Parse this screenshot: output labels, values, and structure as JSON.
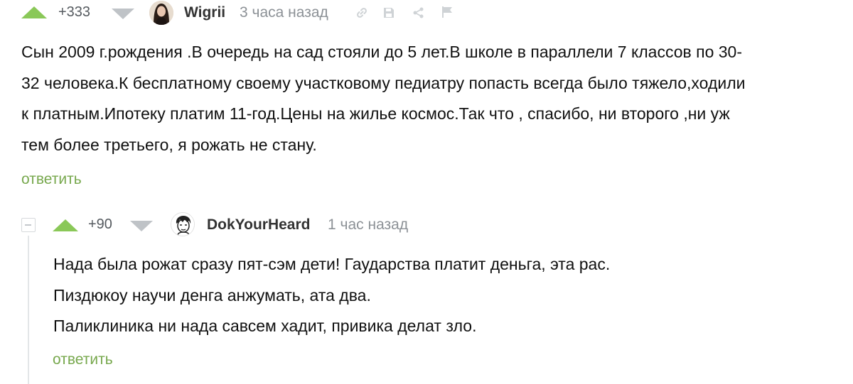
{
  "comment": {
    "rating": "+333",
    "author": "Wigrii",
    "time": "3 часа назад",
    "text_lines": [
      "Сын 2009 г.рождения .В очередь на сад стояли до 5 лет.В школе в параллели 7 классов по 30-",
      "32 человека.К бесплатному своему участковому педиатру попасть всегда было тяжело,ходили",
      "к платным.Ипотеку платим 11-год.Цены на жилье космос.Так что , спасибо, ни второго ,ни уж",
      "тем более третьего, я рожать не стану."
    ],
    "reply_label": "ответить",
    "tool_icons": [
      "link-icon",
      "save-icon",
      "share-icon",
      "flag-icon"
    ]
  },
  "reply": {
    "rating": "+90",
    "author": "DokYourHeard",
    "time": "1 час назад",
    "text_lines": [
      "Нада была рожат сразу пят-сэм дети! Гаударства платит деньга, эта рас.",
      "Пиздюкоу научи денга анжумать, ата два.",
      "Паликлиника ни нада савсем хадит, привика делат зло."
    ],
    "reply_label": "ответить"
  },
  "colors": {
    "upvote": "#8ac858",
    "downvote": "#bfc3c7",
    "reply_link": "#77a84d",
    "time": "#8c9196"
  }
}
